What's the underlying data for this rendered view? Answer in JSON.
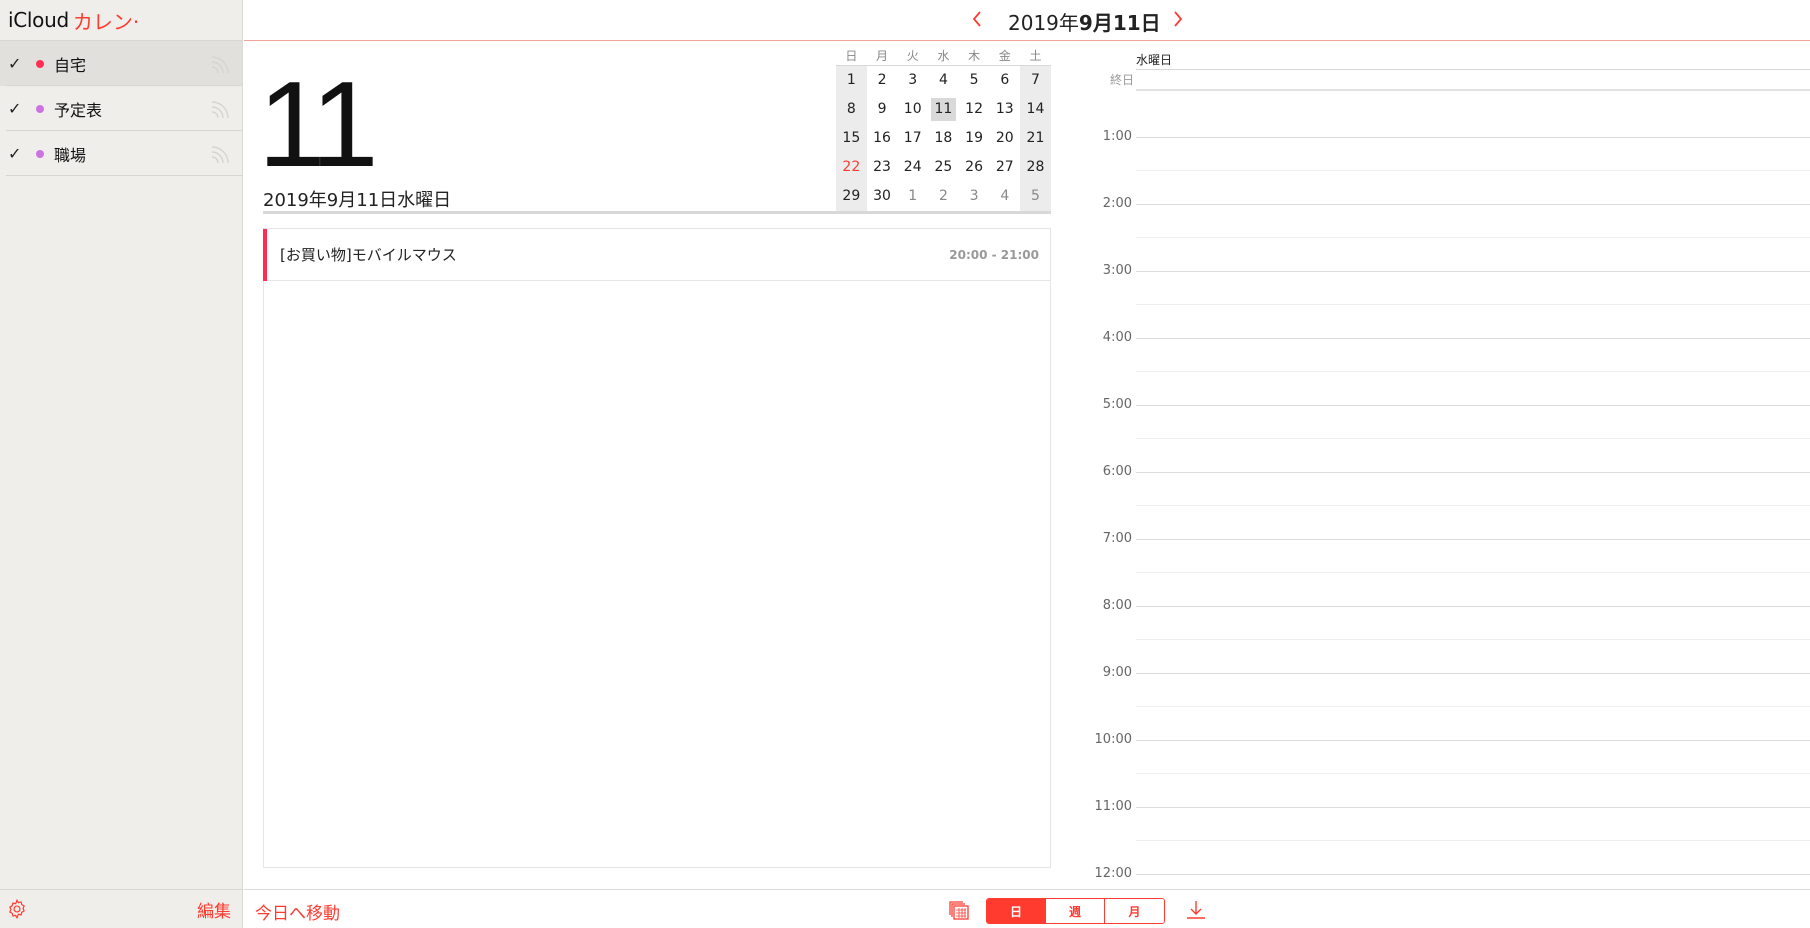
{
  "sidebar": {
    "brand_icloud": "iCloud",
    "brand_cal": "カレン·",
    "calendars": [
      {
        "label": "自宅",
        "color": "#ff2d55",
        "checked": true
      },
      {
        "label": "予定表",
        "color": "#cc73e1",
        "checked": true
      },
      {
        "label": "職場",
        "color": "#cc73e1",
        "checked": true
      }
    ],
    "edit_label": "編集",
    "check_glyph": "✓"
  },
  "topbar": {
    "title_prefix": "2019年",
    "title_bold": "9月11日",
    "prev_glyph": "‹",
    "next_glyph": "›"
  },
  "day": {
    "big_number": "11",
    "full_date": "2019年9月11日水曜日"
  },
  "minical": {
    "weekdays": [
      "日",
      "月",
      "火",
      "水",
      "木",
      "金",
      "土"
    ],
    "weeks": [
      [
        "1",
        "2",
        "3",
        "4",
        "5",
        "6",
        "7"
      ],
      [
        "8",
        "9",
        "10",
        "11",
        "12",
        "13",
        "14"
      ],
      [
        "15",
        "16",
        "17",
        "18",
        "19",
        "20",
        "21"
      ],
      [
        "22",
        "23",
        "24",
        "25",
        "26",
        "27",
        "28"
      ],
      [
        "29",
        "30",
        "1",
        "2",
        "3",
        "4",
        "5"
      ]
    ],
    "selected": "11",
    "highlight_red": "22"
  },
  "events": [
    {
      "title": "[お買い物]モバイルマウス",
      "time": "20:00 - 21:00",
      "color": "#ff2d55"
    }
  ],
  "timeline": {
    "day_name": "水曜日",
    "allday_label": "終日",
    "hours": [
      "1:00",
      "2:00",
      "3:00",
      "4:00",
      "5:00",
      "6:00",
      "7:00",
      "8:00",
      "9:00",
      "10:00",
      "11:00",
      "12:00"
    ]
  },
  "bottombar": {
    "today_label": "今日へ移動",
    "views": [
      {
        "label": "日",
        "active": true
      },
      {
        "label": "週",
        "active": false
      },
      {
        "label": "月",
        "active": false
      }
    ]
  },
  "colors": {
    "accent": "#ff3b30",
    "sidebar_bg": "#efeeeb"
  }
}
